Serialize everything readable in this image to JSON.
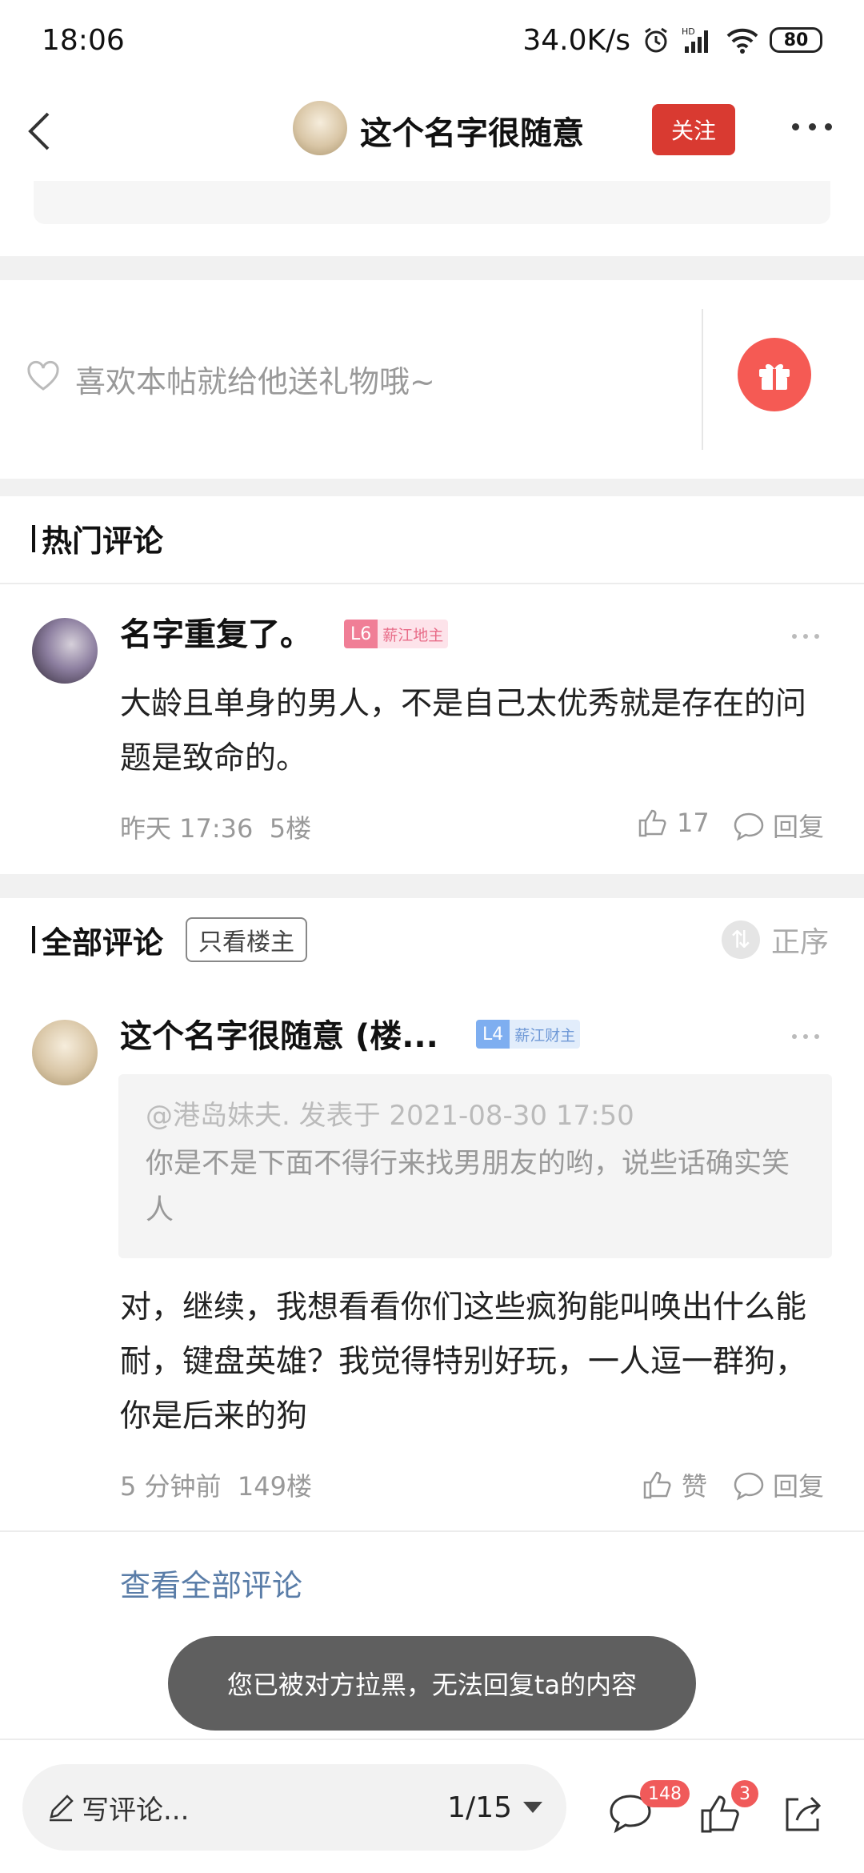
{
  "status_bar": {
    "time": "18:06",
    "network_speed": "34.0K/s",
    "battery": "80",
    "icons": [
      "alarm-icon",
      "hd-signal-icon",
      "wifi-icon",
      "battery-icon"
    ]
  },
  "nav": {
    "author_name": "这个名字很随意",
    "follow_label": "关注",
    "icons": [
      "back-icon",
      "more-icon"
    ]
  },
  "gift": {
    "prompt": "喜欢本帖就给他送礼物哦~",
    "icons": [
      "heart-icon",
      "gift-icon"
    ]
  },
  "hot_comments": {
    "header": "热门评论",
    "items": [
      {
        "username": "名字重复了。",
        "level": "L6",
        "title": "薪江地主",
        "text": "大龄且单身的男人，不是自己太优秀就是存在的问题是致命的。",
        "time": "昨天 17:36",
        "floor": "5楼",
        "likes": "17",
        "reply_label": "回复"
      }
    ]
  },
  "all_comments": {
    "header": "全部评论",
    "only_op_label": "只看楼主",
    "sort_label": "正序",
    "items": [
      {
        "username": "这个名字很随意 (楼...",
        "level": "L4",
        "title": "薪江财主",
        "quote_head": "@港岛妹夫. 发表于 2021-08-30 17:50",
        "quote_text": "你是不是下面不得行来找男朋友的哟，说些话确实笑人",
        "text": "对，继续，我想看看你们这些疯狗能叫唤出什么能耐，键盘英雄？我觉得特别好玩，一人逗一群狗，你是后来的狗",
        "time": "5 分钟前",
        "floor": "149楼",
        "like_label": "赞",
        "reply_label": "回复"
      }
    ],
    "view_all_label": "查看全部评论"
  },
  "toast": "您已被对方拉黑，无法回复ta的内容",
  "bottom_bar": {
    "input_placeholder": "写评论...",
    "page_indicator": "1/15",
    "comment_count": "148",
    "like_count": "3",
    "icons": [
      "pen-icon",
      "comment-icon",
      "thumb-up-icon",
      "share-icon"
    ]
  },
  "colors": {
    "accent_red": "#d93a31",
    "link_blue": "#5a7da8",
    "badge_pink": "#f07e96",
    "badge_blue": "#7eaef0"
  }
}
